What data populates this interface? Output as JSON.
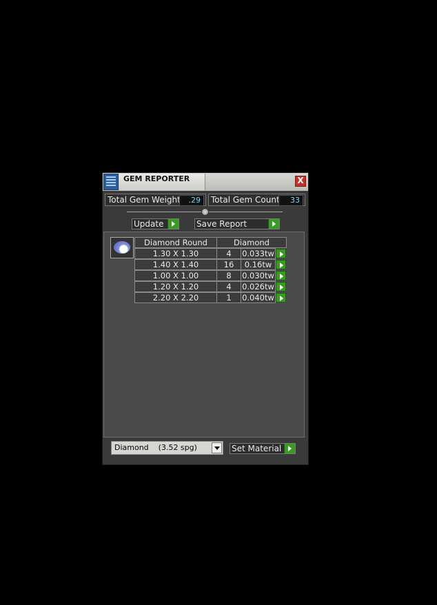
{
  "window": {
    "title": "GEM REPORTER",
    "close_glyph": "X"
  },
  "stats": {
    "weight_label": "Total Gem Weight",
    "weight_value": ".29",
    "count_label": "Total Gem Count",
    "count_value": "33"
  },
  "actions": {
    "update_label": "Update",
    "save_label": "Save Report"
  },
  "table": {
    "headers": [
      "Diamond Round",
      "Diamond"
    ],
    "rows": [
      {
        "size": "1.30 X 1.30",
        "count": "4",
        "weight": "0.033tw"
      },
      {
        "size": "1.40 X 1.40",
        "count": "16",
        "weight": "0.16tw"
      },
      {
        "size": "1.00 X 1.00",
        "count": "8",
        "weight": "0.030tw"
      },
      {
        "size": "1.20 X 1.20",
        "count": "4",
        "weight": "0.026tw"
      },
      {
        "size": "2.20 X 2.20",
        "count": "1",
        "weight": "0.040tw"
      }
    ]
  },
  "material": {
    "selected": "Diamond    (3.52 spg)",
    "set_label": "Set Material"
  },
  "colors": {
    "accent_green": "#3b9a24",
    "value_text": "#7fd3ff",
    "close_red": "#c4302b"
  },
  "icons": [
    "app-grid-icon",
    "close-icon",
    "gem-diamond-icon",
    "arrow-right-icon",
    "chevron-down-icon"
  ]
}
